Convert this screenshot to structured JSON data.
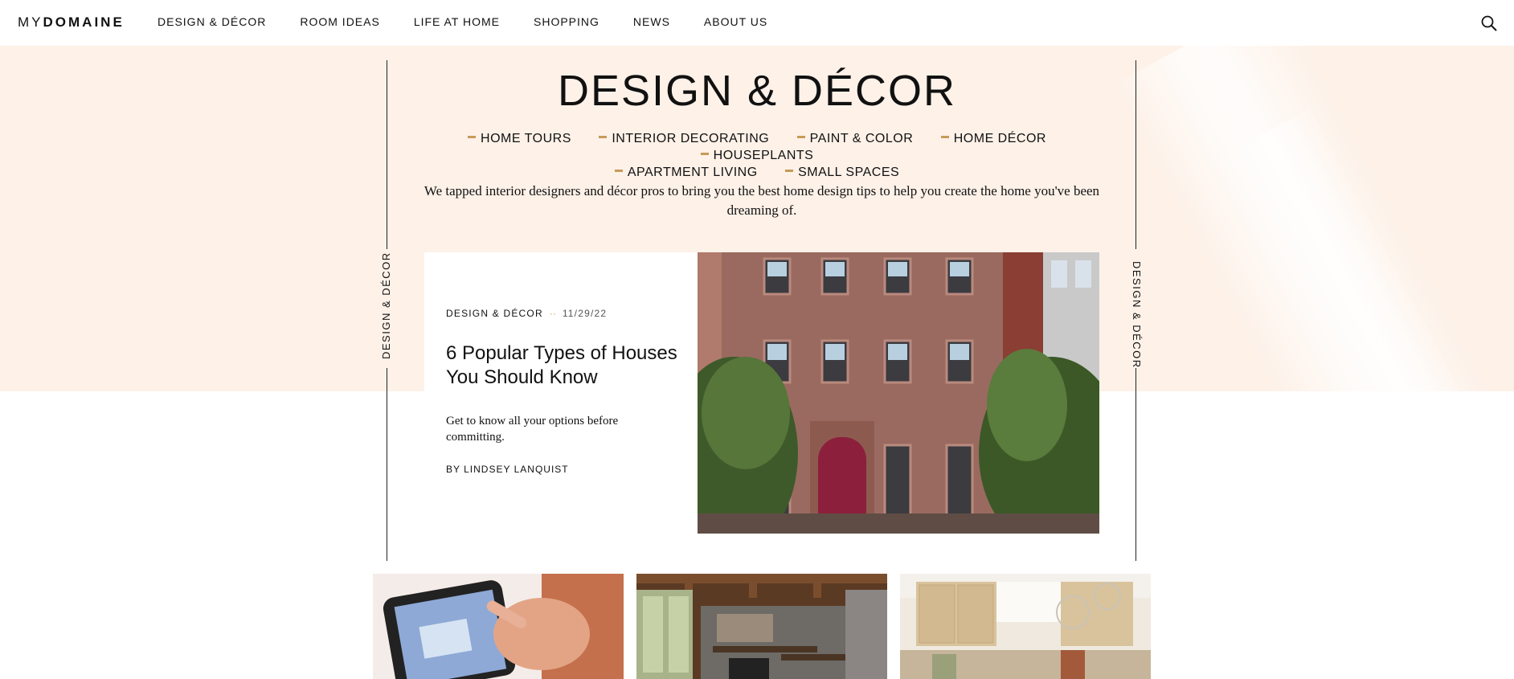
{
  "brand": {
    "logo_my": "MY",
    "logo_domaine": "DOMAINE"
  },
  "nav": {
    "items": [
      "DESIGN & DÉCOR",
      "ROOM IDEAS",
      "LIFE AT HOME",
      "SHOPPING",
      "NEWS",
      "ABOUT US"
    ],
    "search_icon": "search-icon"
  },
  "hero": {
    "title": "DESIGN & DÉCOR",
    "tags": [
      "HOME TOURS",
      "INTERIOR DECORATING",
      "PAINT & COLOR",
      "HOME DÉCOR",
      "HOUSEPLANTS",
      "APARTMENT LIVING",
      "SMALL SPACES"
    ],
    "intro": "We tapped interior designers and décor pros to bring you the best home design tips to help you create the home you've been dreaming of.",
    "side_label": "DESIGN & DÉCOR",
    "background_color": "#fdf1e8",
    "accent_color": "#c79a57"
  },
  "featured": {
    "category": "DESIGN & DÉCOR",
    "separator": "··",
    "date": "11/29/22",
    "title": "6 Popular Types of Houses You Should Know",
    "description": "Get to know all your options before committing.",
    "byline": "BY LINDSEY LANQUIST",
    "image_subject": "brownstone-townhouse-with-red-door"
  },
  "grid": {
    "cards": [
      {
        "image_subject": "hand-using-tablet-floorplan"
      },
      {
        "image_subject": "stone-fireplace-living-room"
      },
      {
        "image_subject": "beige-kitchen-with-pendants"
      }
    ]
  }
}
